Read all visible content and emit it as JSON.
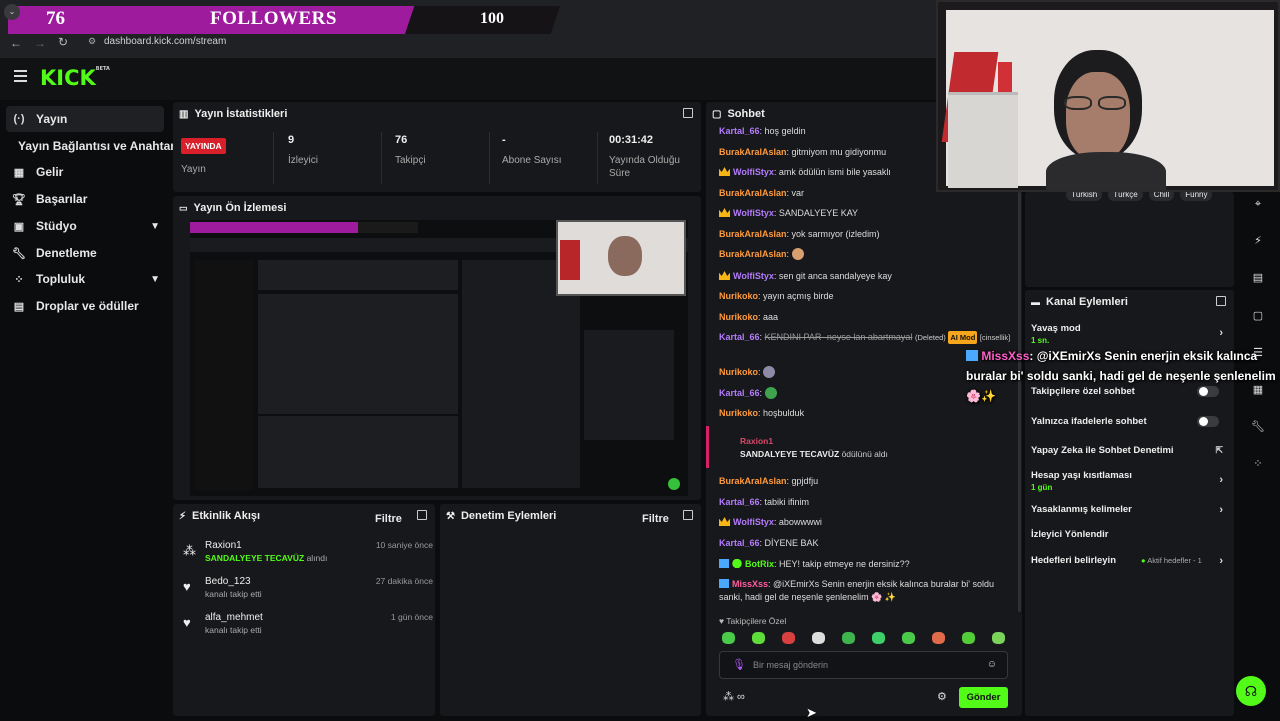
{
  "browser": {
    "url": "dashboard.kick.com/stream"
  },
  "banner": {
    "left_number": "76",
    "title": "FOLLOWERS",
    "right_number": "100"
  },
  "brand": {
    "logo": "KICK",
    "logo_suffix": "BETA",
    "accent": "#53fc18"
  },
  "sidebar": {
    "items": [
      {
        "label": "Yayın",
        "icon": "broadcast-icon"
      },
      {
        "label": "Yayın Bağlantısı ve Anahtarı"
      },
      {
        "label": "Gelir",
        "icon": "money-icon"
      },
      {
        "label": "Başarılar",
        "icon": "trophy-icon"
      },
      {
        "label": "Stüdyo",
        "icon": "studio-icon"
      },
      {
        "label": "Denetleme",
        "icon": "wrench-icon"
      },
      {
        "label": "Topluluk",
        "icon": "community-icon"
      },
      {
        "label": "Droplar ve ödüller",
        "icon": "gift-icon"
      }
    ]
  },
  "stats": {
    "title": "Yayın İstatistikleri",
    "status_badge": "YAYINDA",
    "status_label": "Yayın",
    "viewers": {
      "value": "9",
      "label": "İzleyici"
    },
    "followers": {
      "value": "76",
      "label": "Takipçi"
    },
    "subscribers": {
      "value": "-",
      "label": "Abone Sayısı"
    },
    "uptime": {
      "value": "00:31:42",
      "label": "Yayında Olduğu Süre"
    }
  },
  "preview": {
    "title": "Yayın Ön İzlemesi"
  },
  "activity": {
    "title": "Etkinlik Akışı",
    "filter": "Filtre",
    "events": [
      {
        "name": "Raxion1",
        "detail": "SANDALYEYE TECAVÜZ",
        "detail_suffix": "alındı",
        "time": "10 saniye önce",
        "icon": "reward-icon"
      },
      {
        "name": "Bedo_123",
        "detail": "kanalı takip etti",
        "time": "27 dakika önce",
        "icon": "heart-icon"
      },
      {
        "name": "alfa_mehmet",
        "detail": "kanalı takip etti",
        "time": "1 gün önce",
        "icon": "heart-icon"
      }
    ]
  },
  "moderation": {
    "title": "Denetim Eylemleri",
    "filter": "Filtre"
  },
  "chat": {
    "title": "Sohbet",
    "messages": [
      {
        "user": "Kartal_66",
        "text": "hoş geldin"
      },
      {
        "user": "BurakAralAslan",
        "text": "gitmiyom mu gidiyonmu"
      },
      {
        "user": "WolfiStyx",
        "text": "amk ödülün ismi bile yasaklı"
      },
      {
        "user": "BurakAralAslan",
        "text": "var"
      },
      {
        "user": "WolfiStyx",
        "text": "SANDALYEYE KAY"
      },
      {
        "user": "BurakAralAslan",
        "text": "yok sarmıyor (izledim)"
      },
      {
        "user": "BurakAralAslan",
        "text": ""
      },
      {
        "user": "WolfiStyx",
        "text": "sen git anca sandalyeye kay"
      },
      {
        "user": "Nurikoko",
        "text": "yayın açmış birde"
      },
      {
        "user": "Nurikoko",
        "text": "aaa"
      },
      {
        "user": "Kartal_66",
        "text": "KENDINI PAR- neyse lan abartmayal",
        "deleted": "(Deleted)",
        "ai_mod": "AI Mod",
        "category": "[cinsellik]"
      },
      {
        "user": "Nurikoko",
        "text": ""
      },
      {
        "user": "Kartal_66",
        "text": ""
      },
      {
        "user": "Nurikoko",
        "text": "hoşbulduk"
      },
      {
        "user": "BurakAralAslan",
        "text": "gpjdfju"
      },
      {
        "user": "Kartal_66",
        "text": "tabiki ifinim"
      },
      {
        "user": "WolfiStyx",
        "text": "abowwwwi"
      },
      {
        "user": "Kartal_66",
        "text": "DİYENE BAK"
      },
      {
        "user": "BotRix",
        "text": "HEY! takip etmeye ne dersiniz??"
      },
      {
        "user": "MissXss",
        "text": "@iXEmirXs Senin enerjin eksik kalınca buralar bi' soldu sanki, hadi gel de neşenle şenlenelim 🌸 ✨"
      }
    ],
    "redeem": {
      "user": "Raxion1",
      "reward": "SANDALYEYE TECAVÜZ",
      "suffix": "ödülünü aldı"
    },
    "followers_only": "Takipçilere Özel",
    "input_placeholder": "Bir mesaj gönderin",
    "send": "Gönder"
  },
  "overlay_message": {
    "user": "MissXss",
    "text": ": @iXEmirXs Senin enerjin eksik kalınca buralar bi' soldu sanki, hadi gel de neşenle şenlenelim🌸✨"
  },
  "tags": [
    "Türkish",
    "Türkçe",
    "Chill",
    "Funny"
  ],
  "channel_actions": {
    "title": "Kanal Eylemleri",
    "slow_mode": {
      "label": "Yavaş mod",
      "value": "1 sn."
    },
    "followers_chat": {
      "label": "Takipçilere özel sohbet"
    },
    "emote_only": {
      "label": "Yalnızca ifadelerle sohbet"
    },
    "ai_moderation": {
      "label": "Yapay Zeka ile Sohbet Denetimi"
    },
    "account_age": {
      "label": "Hesap yaşı kısıtlaması",
      "value": "1 gün"
    },
    "banned_words": {
      "label": "Yasaklanmış kelimeler"
    },
    "redirect": {
      "label": "İzleyici Yönlendir"
    },
    "goals": {
      "label": "Hedefleri belirleyin",
      "status": "Aktif hedefler - 1"
    }
  }
}
